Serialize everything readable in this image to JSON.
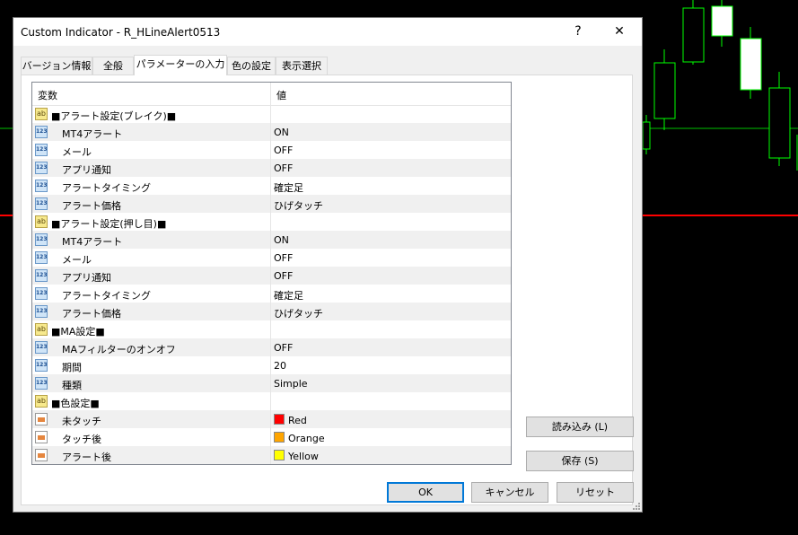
{
  "window": {
    "title": "Custom Indicator - R_HLineAlert0513",
    "help_label": "?",
    "close_label": "✕"
  },
  "tabs": [
    {
      "label": "バージョン情報"
    },
    {
      "label": "全般"
    },
    {
      "label": "パラメーターの入力"
    },
    {
      "label": "色の設定"
    },
    {
      "label": "表示選択"
    }
  ],
  "table": {
    "col_variable": "変数",
    "col_value": "値",
    "rows": [
      {
        "type": "ab",
        "name": "■アラート設定(ブレイク)■",
        "value": ""
      },
      {
        "type": "num",
        "name": "MT4アラート",
        "value": "ON"
      },
      {
        "type": "num",
        "name": "メール",
        "value": "OFF"
      },
      {
        "type": "num",
        "name": "アプリ通知",
        "value": "OFF"
      },
      {
        "type": "num",
        "name": "アラートタイミング",
        "value": "確定足"
      },
      {
        "type": "num",
        "name": "アラート価格",
        "value": "ひげタッチ"
      },
      {
        "type": "ab",
        "name": "■アラート設定(押し目)■",
        "value": ""
      },
      {
        "type": "num",
        "name": "MT4アラート",
        "value": "ON"
      },
      {
        "type": "num",
        "name": "メール",
        "value": "OFF"
      },
      {
        "type": "num",
        "name": "アプリ通知",
        "value": "OFF"
      },
      {
        "type": "num",
        "name": "アラートタイミング",
        "value": "確定足"
      },
      {
        "type": "num",
        "name": "アラート価格",
        "value": "ひげタッチ"
      },
      {
        "type": "ab",
        "name": "■MA設定■",
        "value": ""
      },
      {
        "type": "num",
        "name": "MAフィルターのオンオフ",
        "value": "OFF"
      },
      {
        "type": "num",
        "name": "期間",
        "value": "20"
      },
      {
        "type": "num",
        "name": "種類",
        "value": "Simple"
      },
      {
        "type": "ab",
        "name": "■色設定■",
        "value": ""
      },
      {
        "type": "color",
        "name": "未タッチ",
        "value": "Red",
        "swatch": "#ff0000"
      },
      {
        "type": "color",
        "name": "タッチ後",
        "value": "Orange",
        "swatch": "#ffa500"
      },
      {
        "type": "color",
        "name": "アラート後",
        "value": "Yellow",
        "swatch": "#ffff00"
      }
    ]
  },
  "side_buttons": {
    "load": "読み込み (L)",
    "save": "保存 (S)"
  },
  "footer": {
    "ok": "OK",
    "cancel": "キャンセル",
    "reset": "リセット"
  },
  "icons": {
    "ab_text": "ab",
    "num_text": "123"
  }
}
